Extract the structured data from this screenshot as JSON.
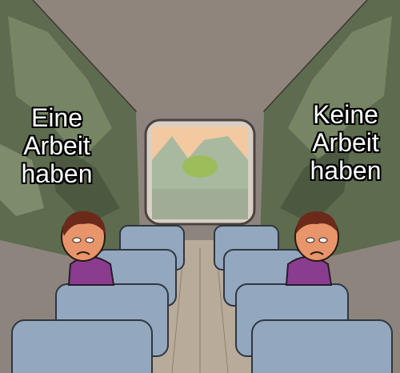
{
  "captions": {
    "left": [
      "Eine",
      "Arbeit",
      "haben"
    ],
    "right": [
      "Keine",
      "Arbeit",
      "haben"
    ]
  },
  "colors": {
    "ceiling": "#a39a92",
    "wall_rock": "#5d6b4e",
    "floor": "#b9ab9a",
    "seat": "#93a8be",
    "seat_shadow": "#6e8196",
    "shirt": "#8a3d8f",
    "skin": "#e8956b",
    "hair": "#6b2a1a",
    "window_sky": "#f2c9a0",
    "window_green": "#9dbd5a",
    "window_water": "#a9b9a0"
  }
}
